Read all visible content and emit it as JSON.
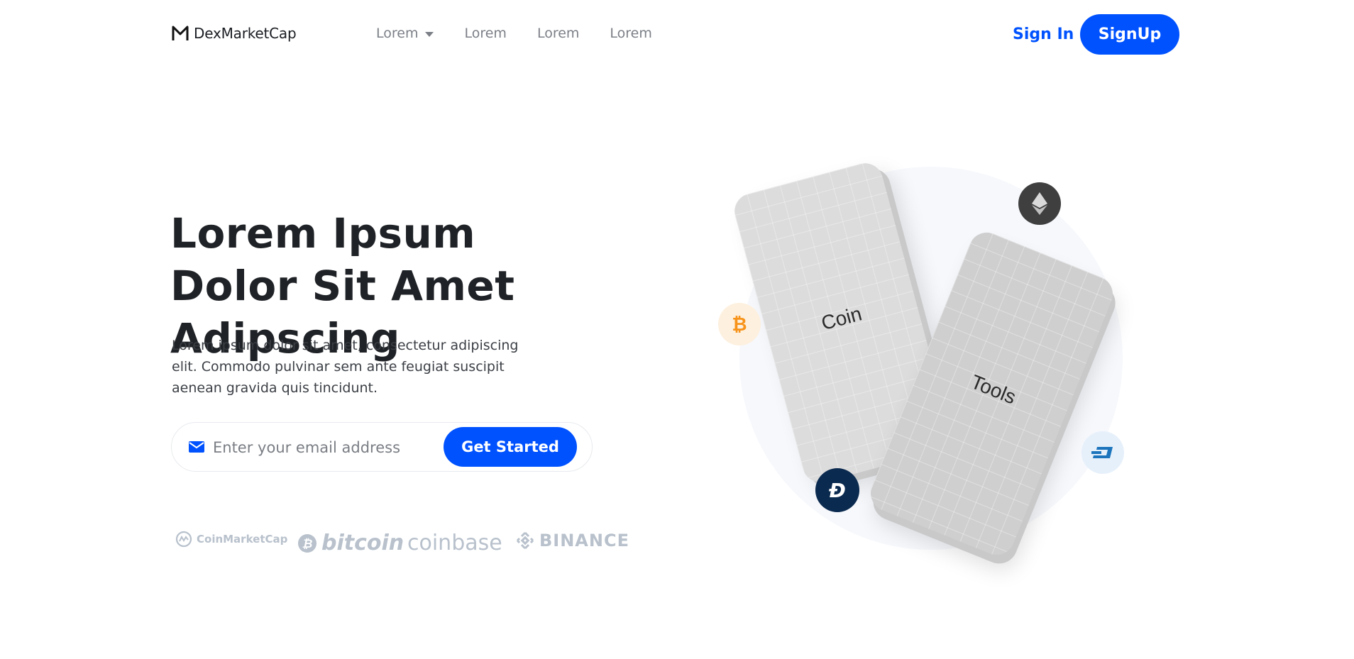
{
  "brand": {
    "name": "DexMarketCap",
    "accent": "#0052ff"
  },
  "nav": {
    "items": [
      {
        "label": "Lorem",
        "dropdown": true
      },
      {
        "label": "Lorem"
      },
      {
        "label": "Lorem"
      },
      {
        "label": "Lorem"
      }
    ],
    "sign_in": "Sign In",
    "sign_up": "SignUp"
  },
  "hero": {
    "title": "Lorem Ipsum Dolor Sit Amet Adipscing",
    "subtitle": "Lorem ipsum dolor sit amet, consectetur adipiscing elit. Commodo pulvinar sem ante feugiat suscipit aenean gravida quis tincidunt.",
    "email_placeholder": "Enter your email address",
    "cta": "Get Started"
  },
  "partners": [
    "CoinMarketCap",
    "bitcoin",
    "coinbase",
    "BINANCE"
  ],
  "illustration": {
    "phone_a": "Coin",
    "phone_b": "Tools",
    "icons": [
      "ethereum-icon",
      "bitcoin-icon",
      "digibyte-icon",
      "dash-icon"
    ]
  }
}
